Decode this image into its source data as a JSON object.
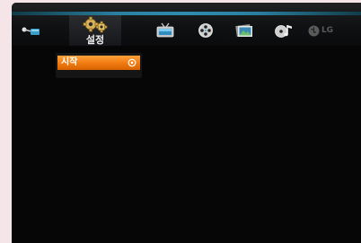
{
  "menu": {
    "items": [
      {
        "id": "input",
        "icon": "input-cable-icon",
        "label": ""
      },
      {
        "id": "settings",
        "icon": "gears-icon",
        "label": "설정"
      },
      {
        "id": "tv",
        "icon": "tv-icon",
        "label": ""
      },
      {
        "id": "movie",
        "icon": "film-reel-icon",
        "label": ""
      },
      {
        "id": "photo",
        "icon": "photo-icon",
        "label": ""
      },
      {
        "id": "music",
        "icon": "music-icon",
        "label": ""
      },
      {
        "id": "lg",
        "icon": "lg-logo",
        "label": "LG"
      }
    ],
    "active": "settings"
  },
  "submenu": {
    "items": [
      {
        "label": "시작",
        "icon": "enter-icon"
      }
    ]
  },
  "colors": {
    "accent_bar": "#2e8db0",
    "highlight": "#f07a10",
    "background": "#060606"
  }
}
